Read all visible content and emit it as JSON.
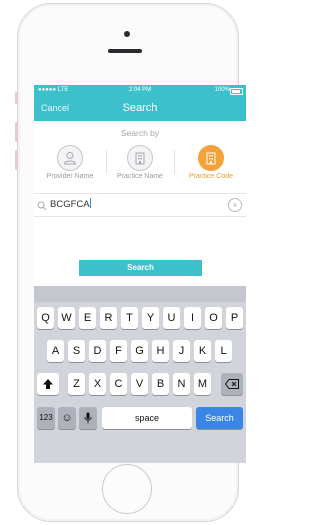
{
  "status_bar": {
    "carrier": "●●●●● LTE",
    "time": "2:04 PM",
    "battery": "100%"
  },
  "nav": {
    "cancel_label": "Cancel",
    "title": "Search"
  },
  "search_by": {
    "heading": "Search by",
    "options": [
      {
        "label": "Provider Name",
        "icon": "person-icon",
        "selected": false
      },
      {
        "label": "Practice Name",
        "icon": "building-icon",
        "selected": false
      },
      {
        "label": "Practice Code",
        "icon": "building-icon",
        "selected": true
      }
    ]
  },
  "search_field": {
    "value": "BCGFCA"
  },
  "search_button_label": "Search",
  "keyboard": {
    "row1": [
      "Q",
      "W",
      "E",
      "R",
      "T",
      "Y",
      "U",
      "I",
      "O",
      "P"
    ],
    "row2": [
      "A",
      "S",
      "D",
      "F",
      "G",
      "H",
      "J",
      "K",
      "L"
    ],
    "row3": [
      "Z",
      "X",
      "C",
      "V",
      "B",
      "N",
      "M"
    ],
    "numbers_label": "123",
    "space_label": "space",
    "search_label": "Search"
  },
  "colors": {
    "accent_teal": "#3cc1cc",
    "selected_orange": "#f6a23a",
    "keyboard_blue": "#3a86e6"
  }
}
